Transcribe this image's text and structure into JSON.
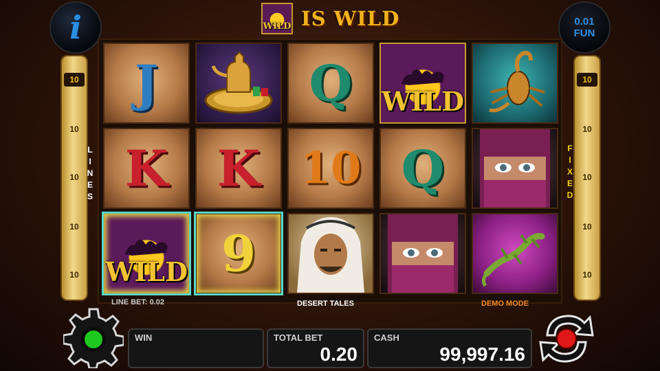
{
  "header": {
    "info_icon": "info-icon",
    "info_glyph": "i",
    "wild_badge": "WILD",
    "title": "IS WILD",
    "denomination_value": "0.01",
    "denomination_currency": "FUN"
  },
  "left_lines": {
    "values": [
      "10",
      "10",
      "10",
      "10",
      "10"
    ],
    "label": [
      "L",
      "I",
      "N",
      "E",
      "S"
    ]
  },
  "right_lines": {
    "values": [
      "10",
      "10",
      "10",
      "10",
      "10"
    ],
    "label": [
      "F",
      "I",
      "X",
      "E",
      "D"
    ]
  },
  "reels": {
    "r1_c1": "J",
    "r1_c3": "Q",
    "r1_c4_wild": "WILD",
    "r2_c1": "K",
    "r2_c2": "K",
    "r2_c3": "10",
    "r2_c4": "Q",
    "r3_c1_wild": "WILD",
    "r3_c2": "9"
  },
  "captions": {
    "line_bet": "LINE BET: 0.02",
    "game_name": "DESERT TALES",
    "mode": "DEMO MODE"
  },
  "bottom": {
    "win_label": "WIN",
    "win_value": "",
    "total_bet_label": "TOTAL BET",
    "total_bet_value": "0.20",
    "cash_label": "CASH",
    "cash_value": "99,997.16"
  },
  "colors": {
    "accent_gold": "#f0b21c",
    "info_blue": "#2b8ee0",
    "caption_orange": "#f08a1c",
    "line_highlight": "#f5c21c",
    "settings_green": "#1ec81e",
    "spin_red": "#e01818"
  }
}
